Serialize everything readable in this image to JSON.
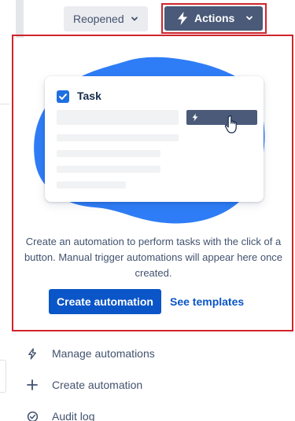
{
  "header": {
    "status_label": "Reopened",
    "actions_label": "Actions"
  },
  "panel": {
    "task_title": "Task",
    "empty_message": "Create an automation to perform tasks with the click of a button. Manual trigger automations will appear here once created.",
    "create_button_label": "Create automation",
    "templates_link_label": "See templates"
  },
  "menu": {
    "items": [
      {
        "label": "Manage automations",
        "icon": "lightning-bolt-outline-icon"
      },
      {
        "label": "Create automation",
        "icon": "plus-icon"
      },
      {
        "label": "Audit log",
        "icon": "check-circle-icon"
      }
    ]
  },
  "colors": {
    "primary": "#0a55c7",
    "actions_bg": "#4a5a78",
    "highlight_border": "#d0242c",
    "blob": "#2f7df6"
  }
}
